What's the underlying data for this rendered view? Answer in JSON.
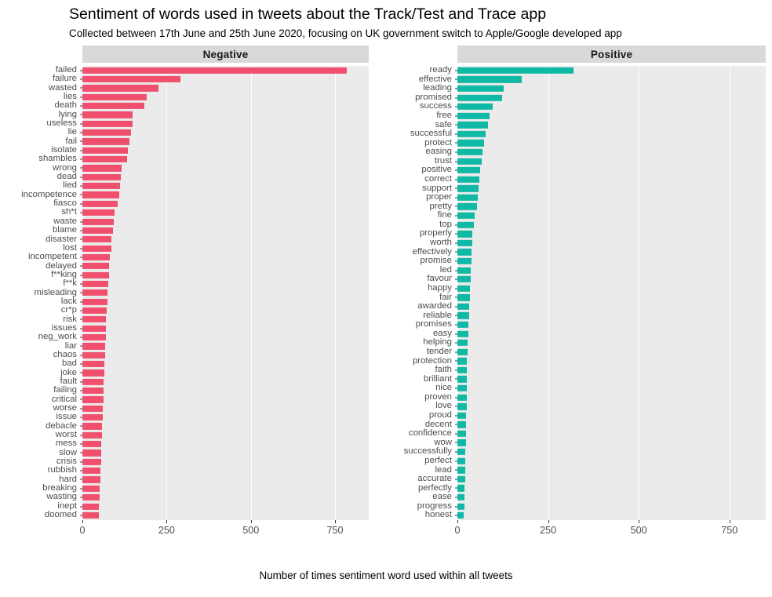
{
  "chart_data": {
    "type": "bar",
    "title": "Sentiment of words used in tweets about the Track/Test and Trace app",
    "subtitle": "Collected between 17th June and 25th June 2020, focusing on UK government switch to Apple/Google developed app",
    "xlabel": "Number of times sentiment word used within all tweets",
    "ylabel": "",
    "orientation": "horizontal",
    "grid": true,
    "legend": "none",
    "xlim": [
      0,
      850
    ],
    "xticks": [
      0,
      250,
      500,
      750
    ],
    "xtick_labels": [
      "0",
      "250",
      "500",
      "750"
    ],
    "facets": [
      {
        "name": "Negative",
        "label": "Negative",
        "color": "#f0506e",
        "categories": [
          "failed",
          "failure",
          "wasted",
          "lies",
          "death",
          "lying",
          "useless",
          "lie",
          "fail",
          "isolate",
          "shambles",
          "wrong",
          "dead",
          "lied",
          "incompetence",
          "fiasco",
          "sh*t",
          "waste",
          "blame",
          "disaster",
          "lost",
          "incompetent",
          "delayed",
          "f**king",
          "f**k",
          "misleading",
          "lack",
          "cr*p",
          "risk",
          "issues",
          "neg_work",
          "liar",
          "chaos",
          "bad",
          "joke",
          "fault",
          "failing",
          "critical",
          "worse",
          "issue",
          "debacle",
          "worst",
          "mess",
          "slow",
          "crisis",
          "rubbish",
          "hard",
          "breaking",
          "wasting",
          "inept",
          "doomed"
        ],
        "values": [
          785,
          290,
          225,
          190,
          185,
          150,
          148,
          145,
          140,
          135,
          132,
          116,
          115,
          112,
          110,
          105,
          95,
          92,
          90,
          87,
          85,
          82,
          80,
          79,
          78,
          75,
          74,
          72,
          71,
          70,
          69,
          68,
          67,
          66,
          65,
          64,
          63,
          62,
          61,
          60,
          59,
          58,
          57,
          56,
          55,
          54,
          53,
          52,
          51,
          50,
          48
        ]
      },
      {
        "name": "Positive",
        "label": "Positive",
        "color": "#0fb9a5",
        "categories": [
          "ready",
          "effective",
          "leading",
          "promised",
          "success",
          "free",
          "safe",
          "successful",
          "protect",
          "easing",
          "trust",
          "positive",
          "correct",
          "support",
          "proper",
          "pretty",
          "fine",
          "top",
          "properly",
          "worth",
          "effectively",
          "promise",
          "led",
          "favour",
          "happy",
          "fair",
          "awarded",
          "reliable",
          "promises",
          "easy",
          "helping",
          "tender",
          "protection",
          "faith",
          "brilliant",
          "nice",
          "proven",
          "love",
          "proud",
          "decent",
          "confidence",
          "wow",
          "successfully",
          "perfect",
          "lead",
          "accurate",
          "perfectly",
          "ease",
          "progress",
          "honest"
        ],
        "values": [
          320,
          177,
          128,
          124,
          98,
          88,
          85,
          78,
          74,
          70,
          67,
          62,
          60,
          58,
          56,
          54,
          48,
          46,
          42,
          41,
          40,
          38,
          37,
          36,
          35,
          34,
          33,
          32,
          31,
          30,
          29,
          28,
          27,
          27,
          26,
          26,
          25,
          25,
          24,
          24,
          23,
          23,
          22,
          22,
          21,
          21,
          20,
          20,
          19,
          18
        ]
      }
    ]
  }
}
